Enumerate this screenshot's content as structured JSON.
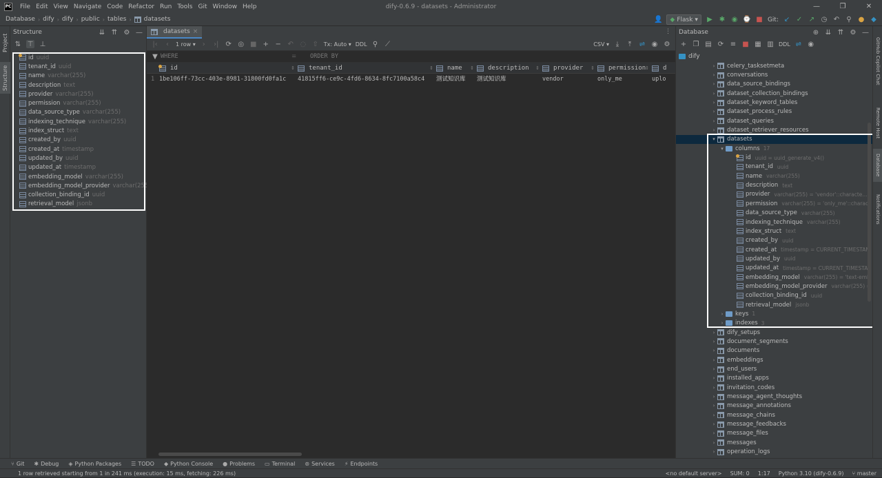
{
  "app": {
    "logo_text": "PC",
    "window_title": "dify-0.6.9 - datasets - Administrator",
    "menu": [
      "File",
      "Edit",
      "View",
      "Navigate",
      "Code",
      "Refactor",
      "Run",
      "Tools",
      "Git",
      "Window",
      "Help"
    ],
    "window_controls": [
      "—",
      "❐",
      "✕"
    ]
  },
  "breadcrumb": [
    "Database",
    "dify",
    "dify",
    "public",
    "tables",
    "datasets"
  ],
  "navbar": {
    "run_config": "Flask",
    "git_label": "Git:"
  },
  "left_strip": {
    "tabs": [
      "Project",
      "Structure"
    ]
  },
  "right_strip": {
    "tabs": [
      "GitHub Copilot Chat",
      "Remote Host",
      "Database",
      "Notifications"
    ]
  },
  "structure": {
    "title": "Structure",
    "columns": [
      {
        "name": "id",
        "type": "uuid",
        "key": true
      },
      {
        "name": "tenant_id",
        "type": "uuid"
      },
      {
        "name": "name",
        "type": "varchar(255)"
      },
      {
        "name": "description",
        "type": "text"
      },
      {
        "name": "provider",
        "type": "varchar(255)"
      },
      {
        "name": "permission",
        "type": "varchar(255)"
      },
      {
        "name": "data_source_type",
        "type": "varchar(255)"
      },
      {
        "name": "indexing_technique",
        "type": "varchar(255)"
      },
      {
        "name": "index_struct",
        "type": "text"
      },
      {
        "name": "created_by",
        "type": "uuid"
      },
      {
        "name": "created_at",
        "type": "timestamp"
      },
      {
        "name": "updated_by",
        "type": "uuid"
      },
      {
        "name": "updated_at",
        "type": "timestamp"
      },
      {
        "name": "embedding_model",
        "type": "varchar(255)"
      },
      {
        "name": "embedding_model_provider",
        "type": "varchar(255)"
      },
      {
        "name": "collection_binding_id",
        "type": "uuid"
      },
      {
        "name": "retrieval_model",
        "type": "jsonb"
      }
    ]
  },
  "editor": {
    "tab_label": "datasets",
    "row_count": "1 row",
    "tx_mode": "Tx: Auto",
    "ddl_label": "DDL",
    "export_format": "CSV",
    "where_label": "WHERE",
    "order_by_label": "ORDER BY",
    "headers": [
      "id",
      "tenant_id",
      "name",
      "description",
      "provider",
      "permission",
      "d"
    ],
    "rows": [
      {
        "num": "1",
        "cells": [
          "1be106ff-73cc-403e-8981-31800fd0fa1c",
          "41815ff6-ce9c-4fd6-8634-8fc7100a58c4",
          "测试知识库",
          "测试知识库",
          "vendor",
          "only_me",
          "uplo"
        ]
      }
    ]
  },
  "database": {
    "title": "Database",
    "ddl_label": "DDL",
    "root": "dify",
    "tables_before": [
      "celery_tasksetmeta",
      "conversations",
      "data_source_bindings",
      "dataset_collection_bindings",
      "dataset_keyword_tables",
      "dataset_process_rules",
      "dataset_queries",
      "dataset_retriever_resources"
    ],
    "selected_table": "datasets",
    "columns_folder": {
      "label": "columns",
      "count": "17"
    },
    "columns": [
      {
        "name": "id",
        "type": "uuid = uuid_generate_v4()",
        "key": true
      },
      {
        "name": "tenant_id",
        "type": "uuid"
      },
      {
        "name": "name",
        "type": "varchar(255)"
      },
      {
        "name": "description",
        "type": "text"
      },
      {
        "name": "provider",
        "type": "varchar(255) = 'vendor'::characte...g"
      },
      {
        "name": "permission",
        "type": "varchar(255) = 'only_me'::charact...g"
      },
      {
        "name": "data_source_type",
        "type": "varchar(255)"
      },
      {
        "name": "indexing_technique",
        "type": "varchar(255)"
      },
      {
        "name": "index_struct",
        "type": "text"
      },
      {
        "name": "created_by",
        "type": "uuid"
      },
      {
        "name": "created_at",
        "type": "timestamp = CURRENT_TIMESTAMP(0)"
      },
      {
        "name": "updated_by",
        "type": "uuid"
      },
      {
        "name": "updated_at",
        "type": "timestamp = CURRENT_TIMESTAMP(0)"
      },
      {
        "name": "embedding_model",
        "type": "varchar(255) = 'text-embedd"
      },
      {
        "name": "embedding_model_provider",
        "type": "varchar(255) = 'ope"
      },
      {
        "name": "collection_binding_id",
        "type": "uuid"
      },
      {
        "name": "retrieval_model",
        "type": "jsonb"
      }
    ],
    "keys_folder": {
      "label": "keys",
      "count": "1"
    },
    "indexes_folder": {
      "label": "indexes",
      "count": "3"
    },
    "tables_after": [
      "dify_setups",
      "document_segments",
      "documents",
      "embeddings",
      "end_users",
      "installed_apps",
      "invitation_codes",
      "message_agent_thoughts",
      "message_annotations",
      "message_chains",
      "message_feedbacks",
      "message_files",
      "messages",
      "operation_logs"
    ]
  },
  "bottom_tools": [
    "Git",
    "Debug",
    "Python Packages",
    "TODO",
    "Python Console",
    "Problems",
    "Terminal",
    "Services",
    "Endpoints"
  ],
  "status": {
    "message": "1 row retrieved starting from 1 in 241 ms (execution: 15 ms, fetching: 226 ms)",
    "server": "<no default server>",
    "sum": "SUM: 0",
    "position": "1:17",
    "interpreter": "Python 3.10 (dify-0.6.9)",
    "branch": "master"
  }
}
